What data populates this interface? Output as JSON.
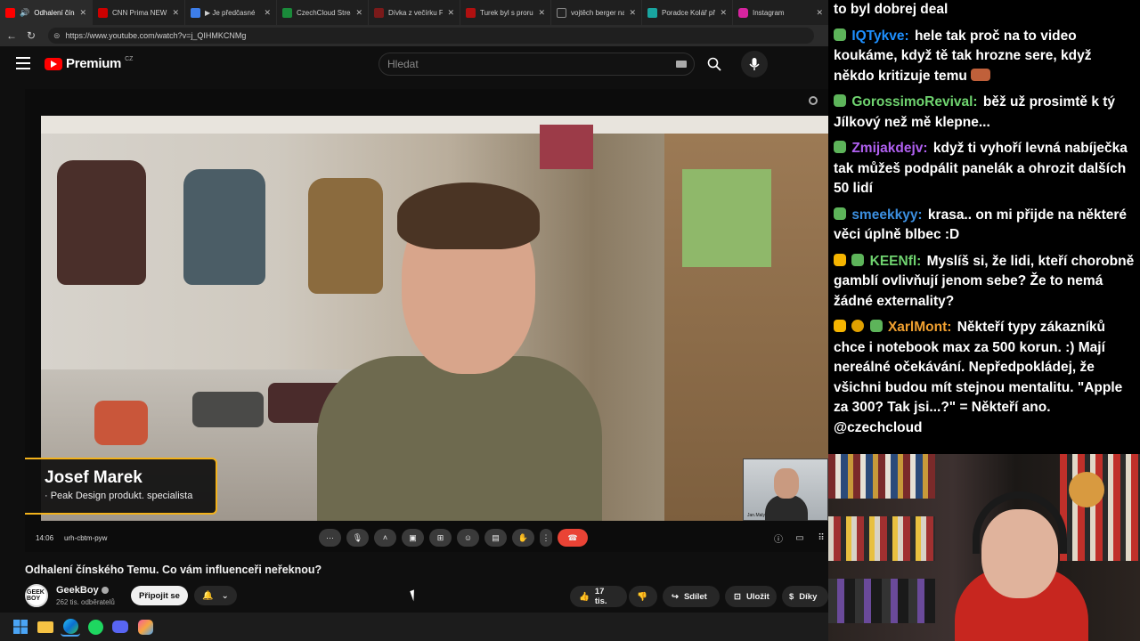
{
  "browser": {
    "tabs": [
      {
        "title": "Odhalení čínsk",
        "fav": "#ff0000",
        "active": true
      },
      {
        "title": "CNN Prima NEWS",
        "fav": "#cc0000"
      },
      {
        "title": "▶ Je předčasné",
        "fav": "#3d7eea"
      },
      {
        "title": "CzechCloud Stream",
        "fav": "#1a8a3a"
      },
      {
        "title": "Dívka z večírku Fi",
        "fav": "#7a1a1a"
      },
      {
        "title": "Turek byl s prorus",
        "fav": "#b01010"
      },
      {
        "title": "vojtěch berger na",
        "fav": "#222222"
      },
      {
        "title": "Poradce Kolář při",
        "fav": "#19a5a0"
      },
      {
        "title": "Instagram",
        "fav": "#d6249f"
      }
    ],
    "url": "https://www.youtube.com/watch?v=j_QIHMKCNMg"
  },
  "youtube": {
    "logo_text": "Premium",
    "region": "CZ",
    "search_placeholder": "Hledat"
  },
  "video": {
    "nameplate_name": "Josef Marek",
    "nameplate_role": "· Peak Design produkt. specialista",
    "pip_label": "Jan.Maly",
    "time": "14:06",
    "meeting_code": "urh-cbtm-pyw",
    "title": "Odhalení čínského Temu. Co vám influenceři neřeknou?"
  },
  "channel": {
    "name": "GeekBoy",
    "subscribers": "262 tis. odběratelů",
    "join_label": "Připojit se",
    "likes": "17 tis.",
    "share_label": "Sdílet",
    "save_label": "Uložit",
    "thanks_label": "Díky",
    "avatar_text": "GEEK BOY"
  },
  "chat": {
    "messages": [
      {
        "user": "",
        "color": "#ffffff",
        "badges": [],
        "text": "to byl dobrej deal"
      },
      {
        "user": "IQTykve:",
        "color": "#1e90ff",
        "badges": [
          "#5db45a"
        ],
        "text": "hele tak proč na to video koukáme, když tě tak hrozne sere, když někdo kritizuje temu"
      },
      {
        "user": "GorossimoRevival:",
        "color": "#6fd36f",
        "badges": [
          "#5db45a"
        ],
        "text": "běž už prosimtě k tý Jílkový než mě klepne..."
      },
      {
        "user": "Zmijakdejv:",
        "color": "#b060f0",
        "badges": [
          "#5db45a"
        ],
        "text": "když ti vyhoří levná nabíječka tak můžeš podpálit panelák a ohrozit dalších 50 lidí"
      },
      {
        "user": "smeekkyy:",
        "color": "#3c8fe0",
        "badges": [
          "#5db45a"
        ],
        "text": "krasa.. on mi přijde na některé věci úplně blbec :D"
      },
      {
        "user": "KEENfl:",
        "color": "#6fd36f",
        "badges": [
          "#f5b400",
          "#5db45a"
        ],
        "text": "Myslíš si, že lidi, kteří chorobně gamblí ovlivňují jenom sebe? Že to nemá žádné externality?"
      },
      {
        "user": "XarlMont:",
        "color": "#f0a030",
        "badges": [
          "#f5b400",
          "#e0a000",
          "#5db45a"
        ],
        "text": "Někteří typy zákazníků chce i notebook max za 500 korun. :) Mají nereálné očekávání. Nepředpokládej, že všichni budou mít stejnou mentalitu. \"Apple za 300? Tak jsi...?\" = Někteří ano. @czechcloud"
      }
    ]
  },
  "colors": {
    "youtube_red": "#ff0000",
    "nameplate_border": "#f3b21b",
    "end_call": "#ea4335"
  },
  "icons": {
    "taskbar": [
      "windows-icon",
      "file-explorer-icon",
      "edge-icon",
      "spotify-icon",
      "discord-icon",
      "copilot-icon"
    ]
  }
}
